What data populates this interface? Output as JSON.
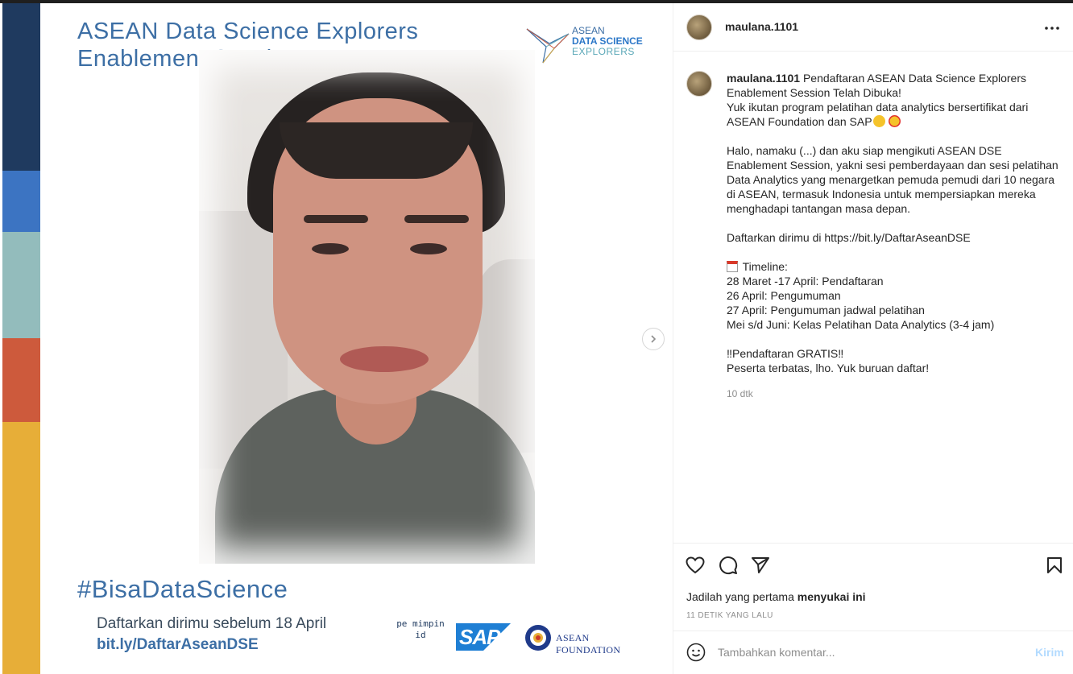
{
  "media": {
    "title_line1": "ASEAN Data Science Explorers",
    "title_line2": "Enablement Session",
    "logo_line1": "ASEAN",
    "logo_line2": "DATA SCIENCE",
    "logo_line3": "EXPLORERS",
    "hashtag": "#BisaDataScience",
    "register_text": "Daftarkan dirimu sebelum 18 April",
    "link_text": "bit.ly/DaftarAseanDSE",
    "partner1": "pe mimpin id",
    "partner2": "SAP",
    "partner3": "ASEAN FOUNDATION",
    "stripe_colors": [
      "#1f3a5f",
      "#3c74c2",
      "#93bcbc",
      "#cd5a3c",
      "#e7ae38"
    ],
    "accent_color": "#3d6fa5"
  },
  "post": {
    "username": "maulana.1101",
    "more_icon": "more-horizontal-icon",
    "caption": {
      "username": "maulana.1101",
      "line1": "Pendaftaran ASEAN Data Science Explorers Enablement Session Telah Dibuka!",
      "line2": "Yuk ikutan program pelatihan data analytics bersertifikat dari ASEAN Foundation dan SAP",
      "para2": "Halo, namaku (...) dan aku siap mengikuti ASEAN DSE Enablement Session, yakni sesi pemberdayaan dan sesi pelatihan Data Analytics yang menargetkan pemuda pemudi dari 10 negara di ASEAN, termasuk Indonesia untuk mempersiapkan mereka menghadapi tantangan masa depan.",
      "para3": "Daftarkan dirimu di https://bit.ly/DaftarAseanDSE",
      "timeline_label": "Timeline:",
      "timeline": [
        "28 Maret -17 April: Pendaftaran",
        "26 April: Pengumuman",
        "27 April: Pengumuman jadwal pelatihan",
        "Mei s/d Juni: Kelas Pelatihan Data Analytics (3-4 jam)"
      ],
      "free_line": "‼Pendaftaran GRATIS‼",
      "closing": "Peserta terbatas, lho. Yuk buruan daftar!"
    },
    "caption_time": "10 dtk",
    "likes_prefix": "Jadilah yang pertama ",
    "likes_bold": "menyukai ini",
    "time_ago": "11 DETIK YANG LALU",
    "comment_placeholder": "Tambahkan komentar...",
    "send_label": "Kirim",
    "send_color": "#b3dbff"
  }
}
